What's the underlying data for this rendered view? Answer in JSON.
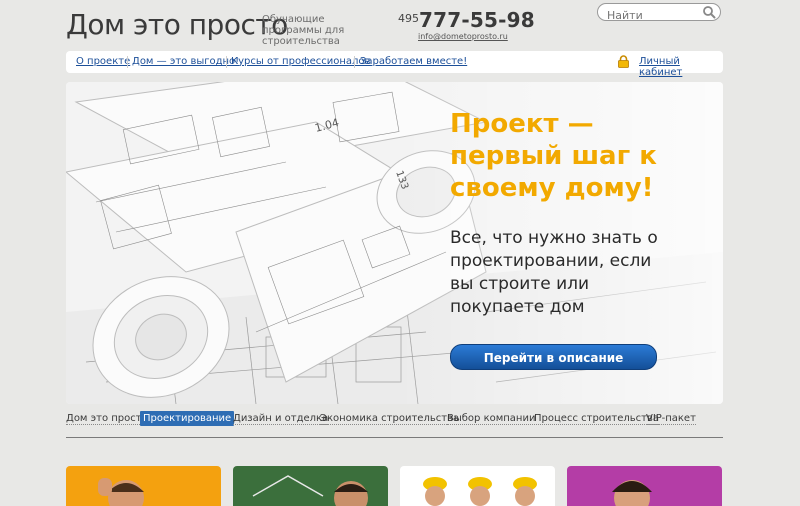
{
  "header": {
    "brand": "Дом это просто",
    "tagline": "Обучающие программы для строительства",
    "phone_code": "495",
    "phone_number": "777-55-98",
    "email": "info@dometoprosto.ru"
  },
  "search": {
    "placeholder": "Найти",
    "icon": "magnifier-icon"
  },
  "topnav": {
    "items": [
      "О проекте",
      "Дом — это выгодно!",
      "Курсы от профессионалов",
      "Заработаем вместе!"
    ],
    "cabinet_label": "Личный кабинет",
    "cabinet_icon": "lock-icon"
  },
  "hero": {
    "title": "Проект — первый шаг к своему дому!",
    "text": "Все, что нужно знать о проектировании, если вы строите или покупаете дом",
    "button": "Перейти в описание"
  },
  "categories": {
    "items": [
      "Дом это просто",
      "Проектирование",
      "Дизайн и отделка",
      "Экономика строительства",
      "Выбор компании",
      "Процесс строительства",
      "VIP-пакет"
    ],
    "active": "Проектирование"
  },
  "colors": {
    "accent": "#f2a900",
    "link": "#1c4f99",
    "button": "#1d63b8",
    "tile_1": "#f4a10f",
    "tile_2": "#3b6f3c",
    "tile_3": "#ffffff",
    "tile_4": "#b43da6"
  }
}
